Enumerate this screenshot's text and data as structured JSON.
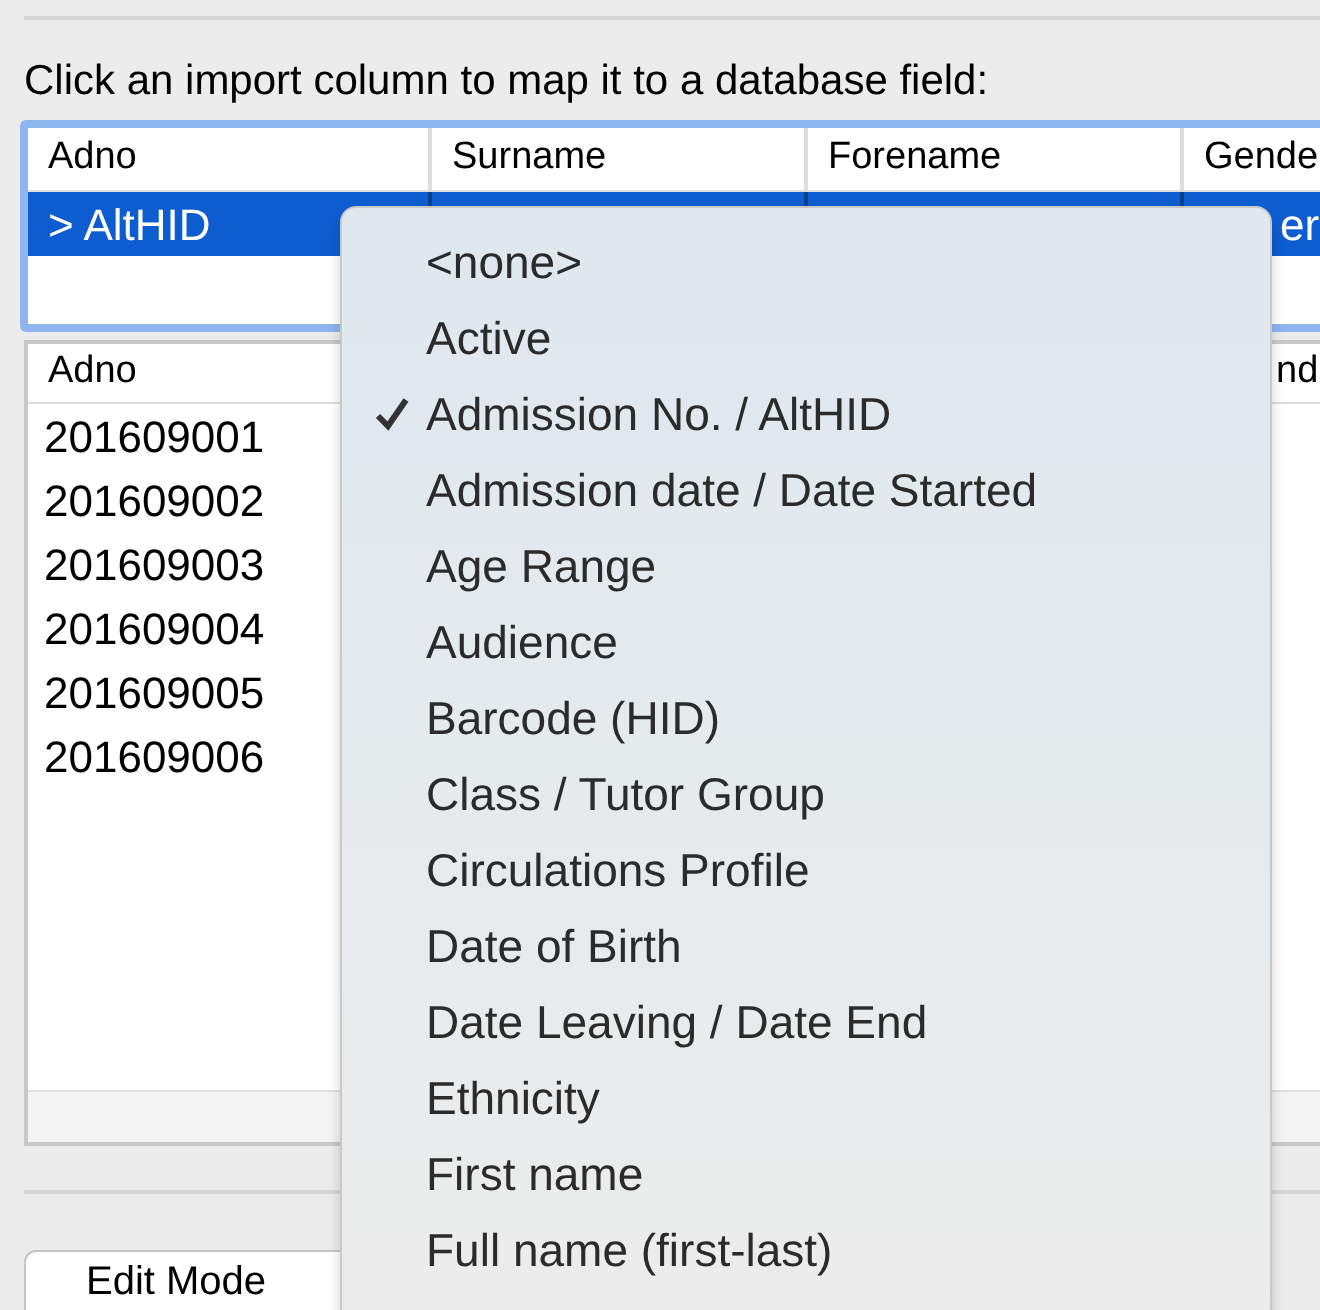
{
  "instruction": "Click an import column to map it to a database field:",
  "mapping_table": {
    "columns": [
      "Adno",
      "Surname",
      "Forename",
      "Gende"
    ],
    "rows": [
      {
        "cells": [
          "> AltHID",
          "",
          "",
          "er"
        ],
        "selected": true
      }
    ]
  },
  "preview_table": {
    "columns": [
      "Adno",
      "nd"
    ],
    "rows": [
      [
        "201609001"
      ],
      [
        "201609002"
      ],
      [
        "201609003"
      ],
      [
        "201609004"
      ],
      [
        "201609005"
      ],
      [
        "201609006"
      ]
    ]
  },
  "buttons": [
    "Edit Mode"
  ],
  "field_menu": {
    "items": [
      {
        "label": "<none>",
        "checked": false
      },
      {
        "label": "Active",
        "checked": false
      },
      {
        "label": "Admission No. / AltHID",
        "checked": true
      },
      {
        "label": "Admission date / Date Started",
        "checked": false
      },
      {
        "label": "Age Range",
        "checked": false
      },
      {
        "label": "Audience",
        "checked": false
      },
      {
        "label": "Barcode (HID)",
        "checked": false
      },
      {
        "label": "Class / Tutor Group",
        "checked": false
      },
      {
        "label": "Circulations Profile",
        "checked": false
      },
      {
        "label": "Date of Birth",
        "checked": false
      },
      {
        "label": "Date Leaving / Date End",
        "checked": false
      },
      {
        "label": "Ethnicity",
        "checked": false
      },
      {
        "label": "First name",
        "checked": false
      },
      {
        "label": "Full name (first-last)",
        "checked": false
      }
    ]
  }
}
